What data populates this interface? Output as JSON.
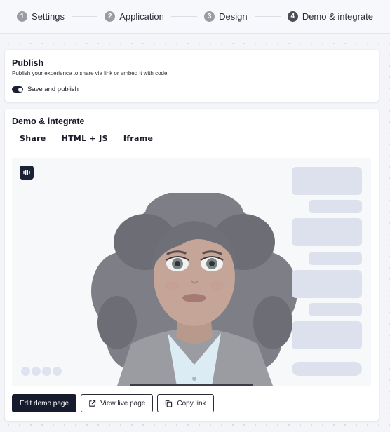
{
  "stepper": {
    "steps": [
      {
        "number": "1",
        "label": "Settings"
      },
      {
        "number": "2",
        "label": "Application"
      },
      {
        "number": "3",
        "label": "Design"
      },
      {
        "number": "4",
        "label": "Demo & integrate"
      }
    ]
  },
  "publish": {
    "title": "Publish",
    "description": "Publish your experience to share via link or embed it with code.",
    "toggle_label": "Save and publish",
    "toggle_on": true
  },
  "demo": {
    "title": "Demo & integrate",
    "tabs": [
      "Share",
      "HTML + JS",
      "Iframe"
    ],
    "active_tab": "Share",
    "preview": {
      "logo_icon": "waveform-logo-icon",
      "avatar": "avatar-woman-curly-hair"
    },
    "buttons": {
      "edit": "Edit demo page",
      "view": "View live page",
      "copy": "Copy link"
    }
  },
  "colors": {
    "primary": "#161c2e",
    "chat_bubble": "#dde1ee",
    "step_inactive": "#9a9ca3"
  }
}
